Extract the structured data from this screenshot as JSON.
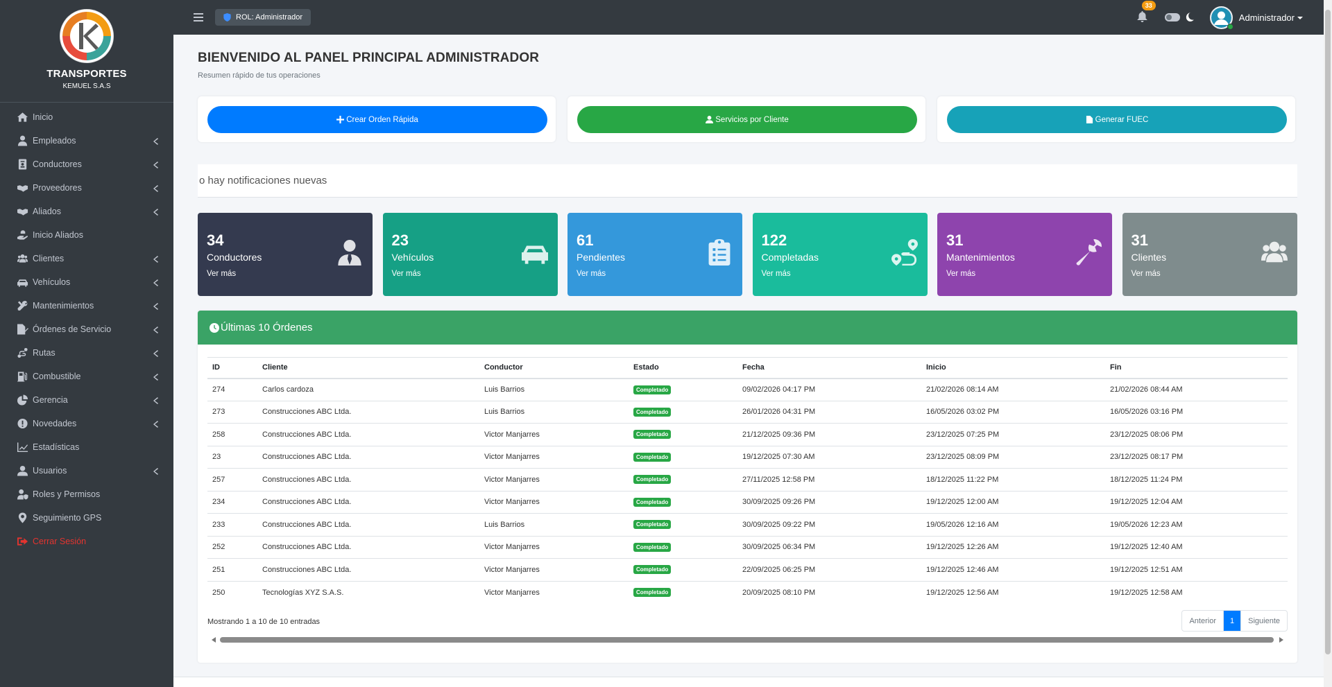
{
  "brand": {
    "title": "TRANSPORTES",
    "subtitle": "KEMUEL S.A.S"
  },
  "sidebar": {
    "items": [
      {
        "label": "Inicio",
        "icon": "home-icon",
        "chevron": false
      },
      {
        "label": "Empleados",
        "icon": "user-tie-icon",
        "chevron": true
      },
      {
        "label": "Conductores",
        "icon": "id-card-icon",
        "chevron": true
      },
      {
        "label": "Proveedores",
        "icon": "handshake-icon",
        "chevron": true
      },
      {
        "label": "Aliados",
        "icon": "handshake-icon",
        "chevron": true
      },
      {
        "label": "Inicio Aliados",
        "icon": "hand-holding-icon",
        "chevron": false
      },
      {
        "label": "Clientes",
        "icon": "users-icon",
        "chevron": true
      },
      {
        "label": "Vehículos",
        "icon": "car-icon",
        "chevron": true
      },
      {
        "label": "Mantenimientos",
        "icon": "tools-icon",
        "chevron": true
      },
      {
        "label": "Órdenes de Servicio",
        "icon": "file-signature-icon",
        "chevron": true
      },
      {
        "label": "Rutas",
        "icon": "route-icon",
        "chevron": true
      },
      {
        "label": "Combustible",
        "icon": "gas-pump-icon",
        "chevron": true
      },
      {
        "label": "Gerencia",
        "icon": "chart-pie-icon",
        "chevron": true
      },
      {
        "label": "Novedades",
        "icon": "exclamation-circle-icon",
        "chevron": true
      },
      {
        "label": "Estadísticas",
        "icon": "chart-line-icon",
        "chevron": false
      },
      {
        "label": "Usuarios",
        "icon": "user-icon",
        "chevron": true
      },
      {
        "label": "Roles y Permisos",
        "icon": "user-shield-icon",
        "chevron": false
      },
      {
        "label": "Seguimiento GPS",
        "icon": "map-marker-icon",
        "chevron": false
      },
      {
        "label": "Cerrar Sesión",
        "icon": "sign-out-icon",
        "chevron": false
      }
    ]
  },
  "topbar": {
    "role_label": "ROL: Administrador",
    "notification_count": "33",
    "user_name": "Administrador"
  },
  "header": {
    "title_prefix": "BIENVENIDO AL PANEL PRINCIPAL",
    "title_bold": "ADMINISTRADOR",
    "subtitle": "Resumen rápido de tus operaciones"
  },
  "quick_actions": [
    {
      "label": "Crear Orden Rápida",
      "color": "#007bff",
      "icon": "plus-icon"
    },
    {
      "label": "Servicios por Cliente",
      "color": "#28a745",
      "icon": "user-icon"
    },
    {
      "label": "Generar FUEC",
      "color": "#17a2b8",
      "icon": "file-icon"
    }
  ],
  "notification_ticker": "o hay notificaciones nuevas",
  "stats": [
    {
      "value": "34",
      "label": "Conductores",
      "more": "Ver más",
      "color": "#343a4f",
      "icon": "user-tie-icon"
    },
    {
      "value": "23",
      "label": "Vehículos",
      "more": "Ver más",
      "color": "#16a085",
      "icon": "car-icon"
    },
    {
      "value": "61",
      "label": "Pendientes",
      "more": "Ver más",
      "color": "#3498db",
      "icon": "clipboard-list-icon"
    },
    {
      "value": "122",
      "label": "Completadas",
      "more": "Ver más",
      "color": "#1abc9c",
      "icon": "route-icon"
    },
    {
      "value": "31",
      "label": "Mantenimientos",
      "more": "Ver más",
      "color": "#8e44ad",
      "icon": "wrench-icon"
    },
    {
      "value": "31",
      "label": "Clientes",
      "more": "Ver más",
      "color": "#7f8c8d",
      "icon": "users-icon"
    }
  ],
  "orders": {
    "title": "Últimas 10 Órdenes",
    "columns": [
      "ID",
      "Cliente",
      "Conductor",
      "Estado",
      "Fecha",
      "Inicio",
      "Fin"
    ],
    "rows": [
      [
        "274",
        "Carlos cardoza",
        "Luis Barrios",
        "Completado",
        "09/02/2026 04:17 PM",
        "21/02/2026 08:14 AM",
        "21/02/2026 08:44 AM"
      ],
      [
        "273",
        "Construcciones ABC Ltda.",
        "Luis Barrios",
        "Completado",
        "26/01/2026 04:31 PM",
        "16/05/2026 03:02 PM",
        "16/05/2026 03:16 PM"
      ],
      [
        "258",
        "Construcciones ABC Ltda.",
        "Victor Manjarres",
        "Completado",
        "21/12/2025 09:36 PM",
        "23/12/2025 07:25 PM",
        "23/12/2025 08:06 PM"
      ],
      [
        "23",
        "Construcciones ABC Ltda.",
        "Victor Manjarres",
        "Completado",
        "19/12/2025 07:30 AM",
        "23/12/2025 08:09 PM",
        "23/12/2025 08:17 PM"
      ],
      [
        "257",
        "Construcciones ABC Ltda.",
        "Victor Manjarres",
        "Completado",
        "27/11/2025 12:58 PM",
        "18/12/2025 11:22 PM",
        "18/12/2025 11:24 PM"
      ],
      [
        "234",
        "Construcciones ABC Ltda.",
        "Victor Manjarres",
        "Completado",
        "30/09/2025 09:26 PM",
        "19/12/2025 12:00 AM",
        "19/12/2025 12:04 AM"
      ],
      [
        "233",
        "Construcciones ABC Ltda.",
        "Luis Barrios",
        "Completado",
        "30/09/2025 09:22 PM",
        "19/05/2026 12:16 AM",
        "19/05/2026 12:23 AM"
      ],
      [
        "252",
        "Construcciones ABC Ltda.",
        "Victor Manjarres",
        "Completado",
        "30/09/2025 06:34 PM",
        "19/12/2025 12:26 AM",
        "19/12/2025 12:40 AM"
      ],
      [
        "251",
        "Construcciones ABC Ltda.",
        "Victor Manjarres",
        "Completado",
        "22/09/2025 06:25 PM",
        "19/12/2025 12:46 AM",
        "19/12/2025 12:51 AM"
      ],
      [
        "250",
        "Tecnologías XYZ S.A.S.",
        "Victor Manjarres",
        "Completado",
        "20/09/2025 08:10 PM",
        "19/12/2025 12:56 AM",
        "19/12/2025 12:58 AM"
      ]
    ],
    "showing": "Mostrando 1 a 10 de 10 entradas",
    "pagination": {
      "prev": "Anterior",
      "current": "1",
      "next": "Siguiente"
    }
  }
}
